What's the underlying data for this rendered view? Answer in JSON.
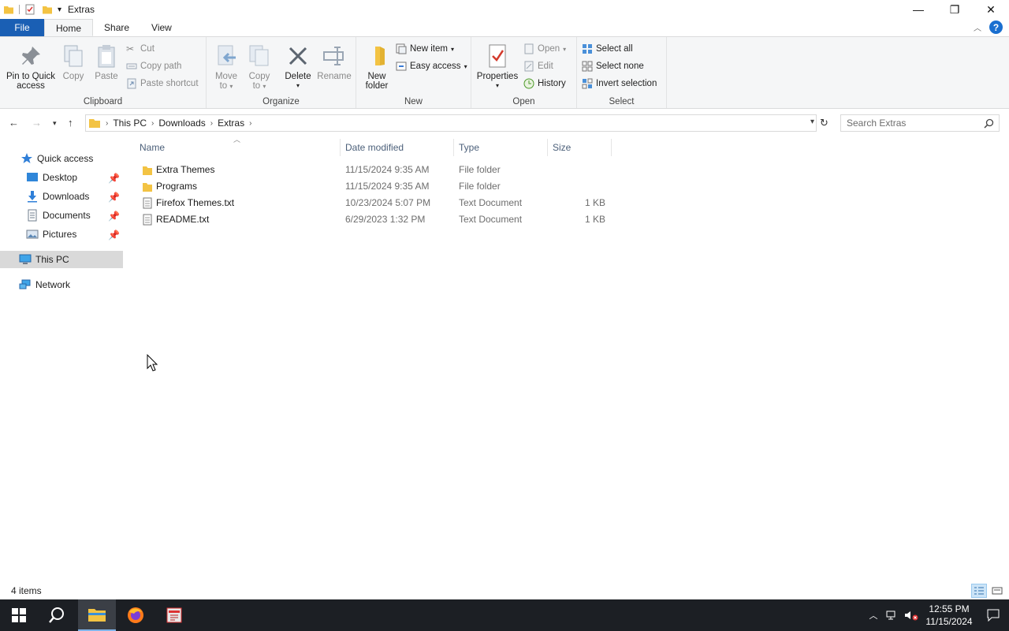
{
  "window": {
    "title": "Extras",
    "minimize_glyph": "—",
    "restore_glyph": "❐",
    "close_glyph": "✕"
  },
  "ribbon_tabs": [
    {
      "label": "File",
      "active": false
    },
    {
      "label": "Home",
      "active": true
    },
    {
      "label": "Share",
      "active": false
    },
    {
      "label": "View",
      "active": false
    }
  ],
  "ribbon": {
    "clipboard": {
      "label": "Clipboard",
      "pin_line1": "Pin to Quick",
      "pin_line2": "access",
      "copy": "Copy",
      "paste": "Paste",
      "cut": "Cut",
      "copy_path": "Copy path",
      "paste_shortcut": "Paste shortcut"
    },
    "organize": {
      "label": "Organize",
      "move_line1": "Move",
      "move_line2": "to",
      "copy_line1": "Copy",
      "copy_line2": "to",
      "delete": "Delete",
      "rename": "Rename"
    },
    "new": {
      "label": "New",
      "folder_line1": "New",
      "folder_line2": "folder",
      "new_item": "New item",
      "easy_access": "Easy access"
    },
    "open": {
      "label": "Open",
      "properties": "Properties",
      "open": "Open",
      "edit": "Edit",
      "history": "History"
    },
    "select": {
      "label": "Select",
      "select_all": "Select all",
      "select_none": "Select none",
      "invert": "Invert selection"
    }
  },
  "address": {
    "crumbs": [
      "This PC",
      "Downloads",
      "Extras"
    ],
    "search_placeholder": "Search Extras"
  },
  "nav_pane": {
    "quick_access": "Quick access",
    "items": [
      {
        "label": "Desktop",
        "pinned": true
      },
      {
        "label": "Downloads",
        "pinned": true
      },
      {
        "label": "Documents",
        "pinned": true
      },
      {
        "label": "Pictures",
        "pinned": true
      }
    ],
    "this_pc": "This PC",
    "network": "Network"
  },
  "file_list": {
    "columns": [
      "Name",
      "Date modified",
      "Type",
      "Size"
    ],
    "rows": [
      {
        "name": "Extra Themes",
        "date": "11/15/2024 9:35 AM",
        "type": "File folder",
        "size": "",
        "kind": "folder"
      },
      {
        "name": "Programs",
        "date": "11/15/2024 9:35 AM",
        "type": "File folder",
        "size": "",
        "kind": "folder"
      },
      {
        "name": "Firefox Themes.txt",
        "date": "10/23/2024 5:07 PM",
        "type": "Text Document",
        "size": "1 KB",
        "kind": "text"
      },
      {
        "name": "README.txt",
        "date": "6/29/2023 1:32 PM",
        "type": "Text Document",
        "size": "1 KB",
        "kind": "text"
      }
    ]
  },
  "status": {
    "item_count": "4 items"
  },
  "taskbar": {
    "time": "12:55 PM",
    "date": "11/15/2024"
  },
  "colors": {
    "accent": "#1a5fb4",
    "folder": "#f3c343",
    "selection": "#d9d9d9",
    "taskbar": "#1c1f24"
  }
}
